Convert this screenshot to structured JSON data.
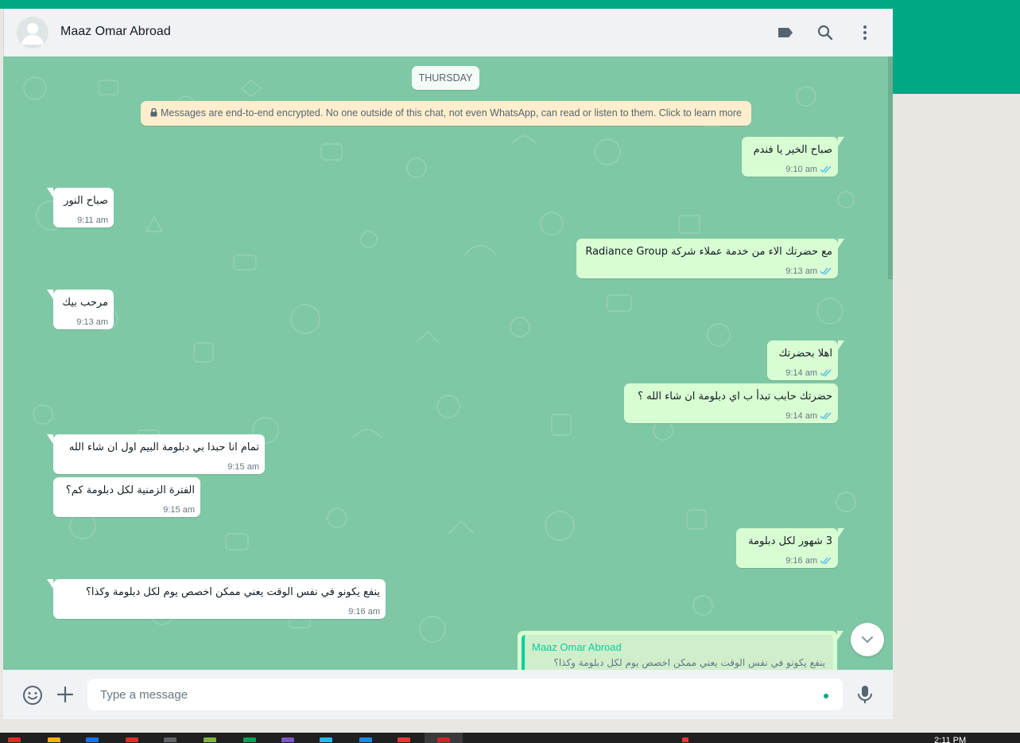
{
  "header": {
    "contact_name": "Maaz Omar Abroad",
    "icons": [
      "labels-icon",
      "search-icon",
      "menu-icon"
    ]
  },
  "chat": {
    "date_label": "THURSDAY",
    "encryption_notice": "Messages are end-to-end encrypted. No one outside of this chat, not even WhatsApp, can read or listen to them. Click to learn more",
    "messages": [
      {
        "direction": "out",
        "text": "صباح الخير يا فندم",
        "time": "9:10 am",
        "status": "read"
      },
      {
        "direction": "in",
        "text": "صباح النور",
        "time": "9:11 am"
      },
      {
        "direction": "out",
        "text": "مع حضرتك الاء من خدمة عملاء شركة Radiance Group",
        "time": "9:13 am",
        "status": "read"
      },
      {
        "direction": "in",
        "text": "مرحب بيك",
        "time": "9:13 am"
      },
      {
        "direction": "out",
        "text": "اهلا بحضرتك",
        "time": "9:14 am",
        "status": "read"
      },
      {
        "direction": "out",
        "text": "حضرتك حابب تبدأ ب اي دبلومة ان شاء الله ؟",
        "time": "9:14 am",
        "status": "read"
      },
      {
        "direction": "in",
        "text": "تمام انا حبدا بي دبلومة البيم اول ان شاء الله",
        "time": "9:15 am"
      },
      {
        "direction": "in",
        "text": "الفترة الزمنية لكل دبلومة كم؟",
        "time": "9:15 am"
      },
      {
        "direction": "out",
        "text": "3 شهور لكل دبلومة",
        "time": "9:16 am",
        "status": "read"
      },
      {
        "direction": "in",
        "text": "ينفع يكونو في نفس الوقت يعني ممكن اخصص يوم لكل دبلومة وكذا؟",
        "time": "9:16 am"
      }
    ],
    "reply_preview": {
      "sender": "Maaz Omar Abroad",
      "quoted_text": "ينفع يكونو في نفس الوقت يعني ممكن اخصص يوم لكل دبلومة وكذا؟"
    }
  },
  "composer": {
    "placeholder": "Type a message"
  },
  "taskbar": {
    "clock": "2:11 PM"
  },
  "colors": {
    "brand": "#00a884",
    "chat_background": "#7fc8a5",
    "outgoing_bubble": "#d9fdd3",
    "incoming_bubble": "#ffffff",
    "read_tick": "#53bdeb"
  }
}
